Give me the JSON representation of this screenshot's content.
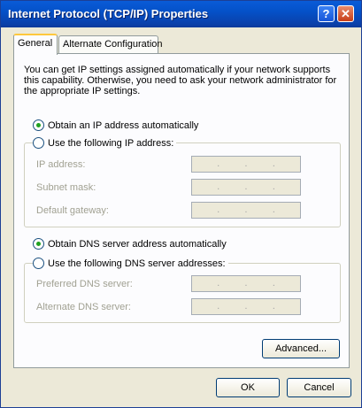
{
  "window": {
    "title": "Internet Protocol (TCP/IP) Properties",
    "help_glyph": "?",
    "close_glyph": "✕"
  },
  "tabs": [
    {
      "label": "General",
      "active": true
    },
    {
      "label": "Alternate Configuration",
      "active": false
    }
  ],
  "general": {
    "description": "You can get IP settings assigned automatically if your network supports this capability. Otherwise, you need to ask your network administrator for the appropriate IP settings.",
    "ip": {
      "auto_label": "Obtain an IP address automatically",
      "manual_label": "Use the following IP address:",
      "selected": "auto",
      "fields": [
        {
          "label": "IP address:",
          "value": ""
        },
        {
          "label": "Subnet mask:",
          "value": ""
        },
        {
          "label": "Default gateway:",
          "value": ""
        }
      ]
    },
    "dns": {
      "auto_label": "Obtain DNS server address automatically",
      "manual_label": "Use the following DNS server addresses:",
      "selected": "auto",
      "fields": [
        {
          "label": "Preferred DNS server:",
          "value": ""
        },
        {
          "label": "Alternate DNS server:",
          "value": ""
        }
      ]
    },
    "advanced_label": "Advanced..."
  },
  "footer": {
    "ok_label": "OK",
    "cancel_label": "Cancel"
  },
  "colors": {
    "titlebar": "#0451c8",
    "dialog_bg": "#ece9d8",
    "tab_highlight": "#ffc83c",
    "radio_selected": "#21a121",
    "disabled_text": "#a1a192"
  }
}
